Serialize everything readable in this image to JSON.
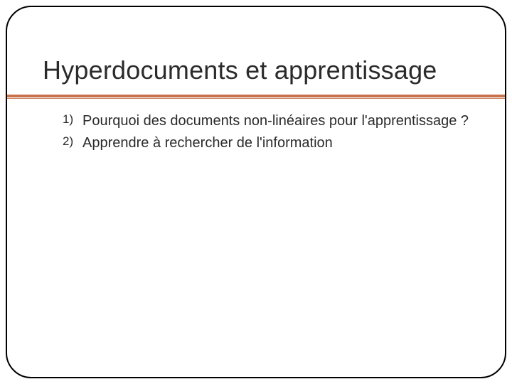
{
  "slide": {
    "title": "Hyperdocuments et apprentissage",
    "items": [
      "Pourquoi des documents non-linéaires pour l'apprentissage ?",
      "Apprendre à rechercher de l'information"
    ]
  },
  "colors": {
    "accent": "#c8724b",
    "text": "#2b2b2b"
  }
}
